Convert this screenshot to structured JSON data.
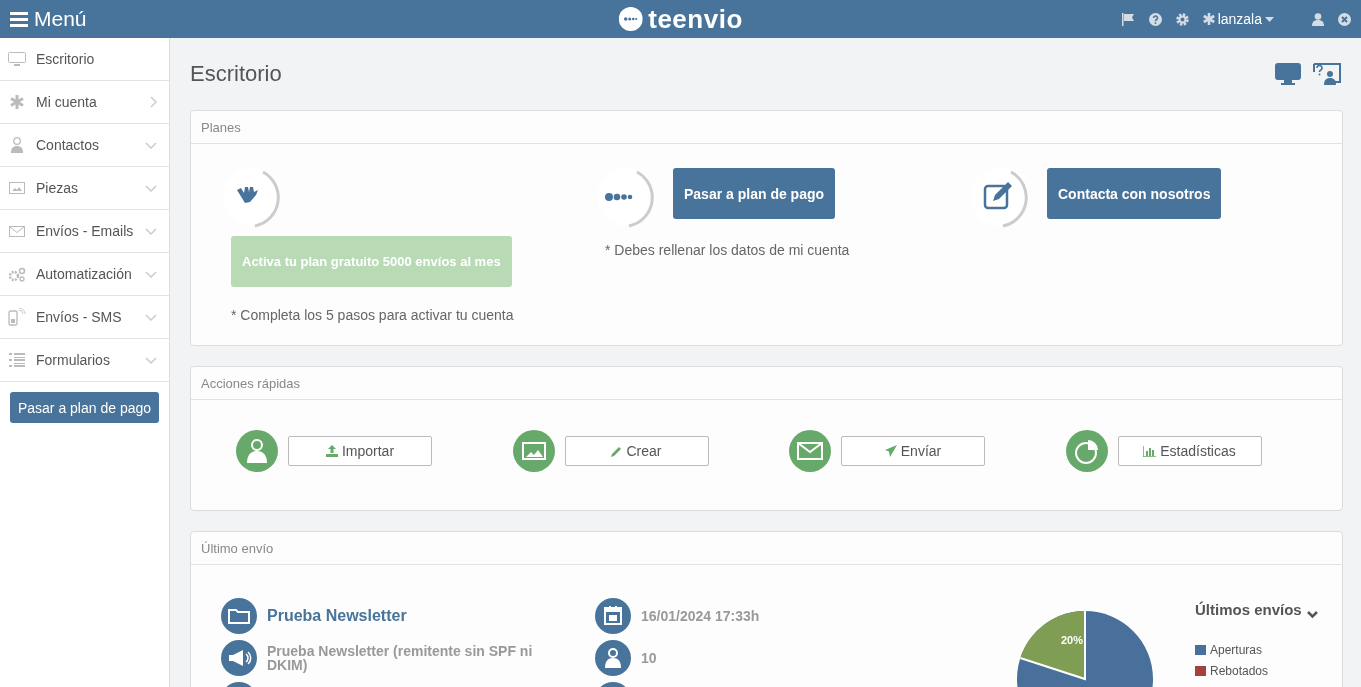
{
  "topbar": {
    "menu_label": "Menú",
    "logo_text": "teenvio",
    "user": "lanzala"
  },
  "sidebar": {
    "items": [
      {
        "label": "Escritorio",
        "kind": "plain"
      },
      {
        "label": "Mi cuenta",
        "kind": "link"
      },
      {
        "label": "Contactos",
        "kind": "submenu"
      },
      {
        "label": "Piezas",
        "kind": "submenu"
      },
      {
        "label": "Envíos - Emails",
        "kind": "submenu"
      },
      {
        "label": "Automatización",
        "kind": "submenu"
      },
      {
        "label": "Envíos - SMS",
        "kind": "submenu"
      },
      {
        "label": "Formularios",
        "kind": "submenu"
      }
    ],
    "button": "Pasar a plan de pago"
  },
  "page": {
    "title": "Escritorio"
  },
  "plans_panel": {
    "title": "Planes",
    "plans": [
      {
        "kind": "free",
        "button": "Activa tu plan gratuito 5000 envíos al mes",
        "note": "* Completa los 5 pasos para activar tu cuenta"
      },
      {
        "kind": "paid",
        "button": "Pasar a plan de pago",
        "note": "* Debes rellenar los datos de mi cuenta"
      },
      {
        "kind": "contact",
        "button": "Contacta con nosotros"
      }
    ]
  },
  "quick_actions": {
    "title": "Acciones rápidas",
    "actions": [
      {
        "label": "Importar"
      },
      {
        "label": "Crear"
      },
      {
        "label": "Envíar"
      },
      {
        "label": "Estadísticas"
      }
    ]
  },
  "last_send": {
    "title": "Último envío",
    "name": "Prueba Newsletter",
    "subject": "Prueba Newsletter (remitente sin SPF ni DKIM)",
    "date": "16/01/2024 17:33h",
    "recipients": "10",
    "dropdown": "Últimos envíos",
    "pie_label": "20%",
    "legend": [
      {
        "label": "Aperturas",
        "color": "#48709a"
      },
      {
        "label": "Rebotados",
        "color": "#a3423c"
      }
    ]
  }
}
